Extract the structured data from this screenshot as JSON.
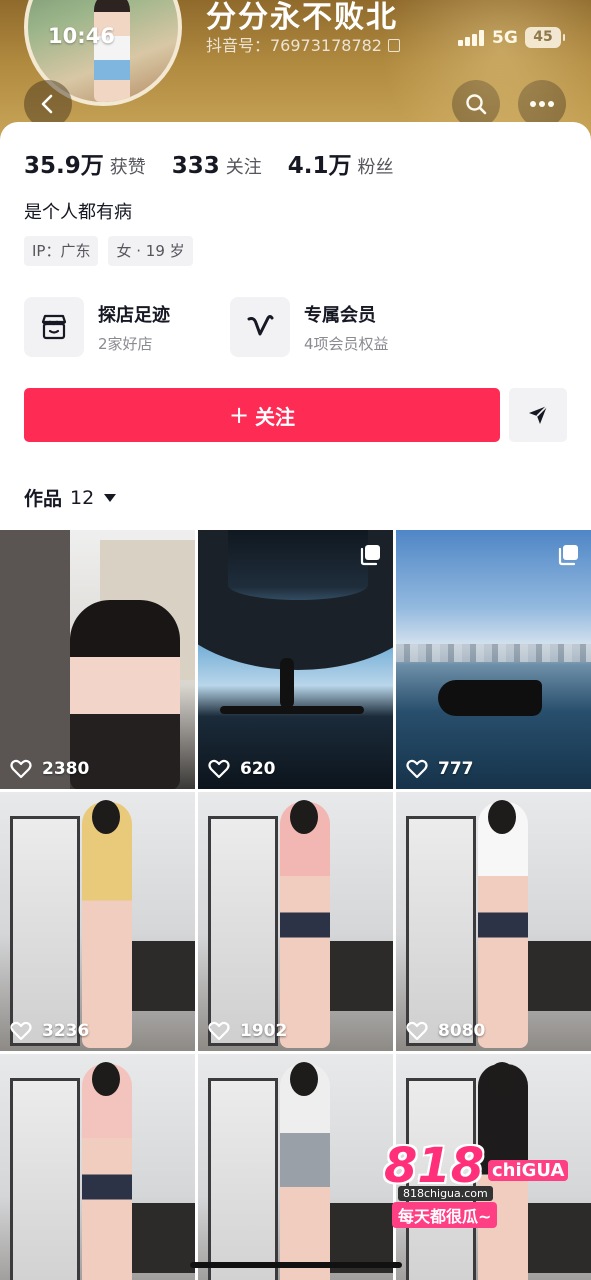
{
  "status_bar": {
    "time": "10:46",
    "network": "5G",
    "battery": "45"
  },
  "profile": {
    "nickname": "分分永不败北",
    "douyin_id": "抖音号：76973178782",
    "stats": [
      {
        "value": "35.9万",
        "label": "获赞"
      },
      {
        "value": "333",
        "label": "关注"
      },
      {
        "value": "4.1万",
        "label": "粉丝"
      }
    ],
    "bio": "是个人都有病",
    "tags": [
      "IP：广东",
      "女 · 19 岁"
    ],
    "features": [
      {
        "title": "探店足迹",
        "subtitle": "2家好店",
        "icon": "shop-icon"
      },
      {
        "title": "专属会员",
        "subtitle": "4项会员权益",
        "icon": "vip-v-icon"
      }
    ],
    "follow_label": "关注",
    "works_label": "作品",
    "works_count": "12"
  },
  "colors": {
    "accent": "#fe2c55",
    "header": "#b08a3f"
  },
  "works": [
    {
      "likes": "2380",
      "multi": false,
      "scene": "kitchen"
    },
    {
      "likes": "620",
      "multi": true,
      "scene": "cave"
    },
    {
      "likes": "777",
      "multi": true,
      "scene": "sea"
    },
    {
      "likes": "3236",
      "multi": false,
      "scene": "room-yellow"
    },
    {
      "likes": "1902",
      "multi": false,
      "scene": "room-pink"
    },
    {
      "likes": "8080",
      "multi": false,
      "scene": "room-white"
    },
    {
      "likes": "",
      "multi": false,
      "scene": "room-pink"
    },
    {
      "likes": "",
      "multi": false,
      "scene": "room-white"
    },
    {
      "likes": "",
      "multi": false,
      "scene": "room-black"
    }
  ],
  "watermark": {
    "big": "818",
    "brand": "chiGUA",
    "url": "818chigua.com",
    "slogan": "每天都很瓜~"
  }
}
